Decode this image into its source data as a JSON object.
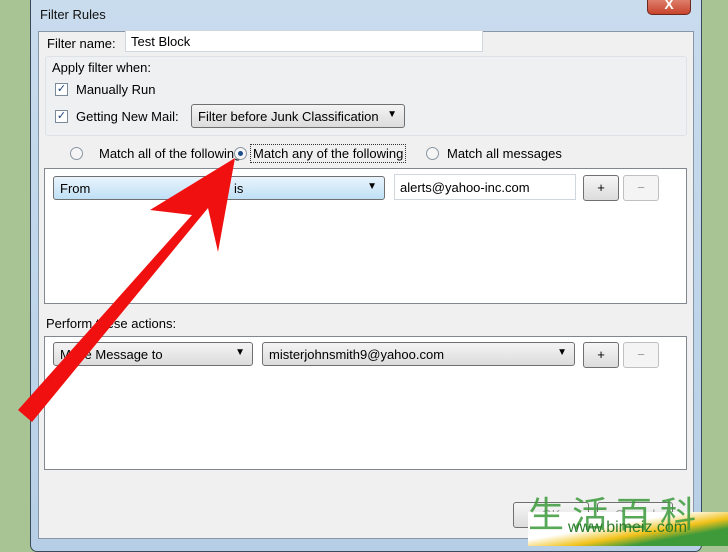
{
  "window": {
    "title": "Filter Rules",
    "close_label": "X"
  },
  "filter_name": {
    "label": "Filter name:",
    "value": "Test Block"
  },
  "apply": {
    "label": "Apply filter when:",
    "manually_run": {
      "label": "Manually Run",
      "checked": true
    },
    "new_mail": {
      "label": "Getting New Mail:",
      "checked": true,
      "option": "Filter before Junk Classification"
    }
  },
  "match": {
    "options": [
      {
        "label": "Match all of the following",
        "selected": false
      },
      {
        "label": "Match any of the following",
        "selected": true
      },
      {
        "label": "Match all messages",
        "selected": false
      }
    ]
  },
  "rule": {
    "field": "From",
    "operator": "is",
    "value": "alerts@yahoo-inc.com",
    "add": "+",
    "remove": "−"
  },
  "actions": {
    "label": "Perform these actions:",
    "action": "Move Message to",
    "target": "misterjohnsmith9@yahoo.com",
    "add": "+",
    "remove": "−"
  },
  "footer": {
    "ok": "OK",
    "cancel": "Cancel"
  },
  "watermark": {
    "text": "生活百科",
    "url": "www.bimeiz.com"
  },
  "colors": {
    "arrow": "#f01010",
    "background": "#a8c495"
  }
}
